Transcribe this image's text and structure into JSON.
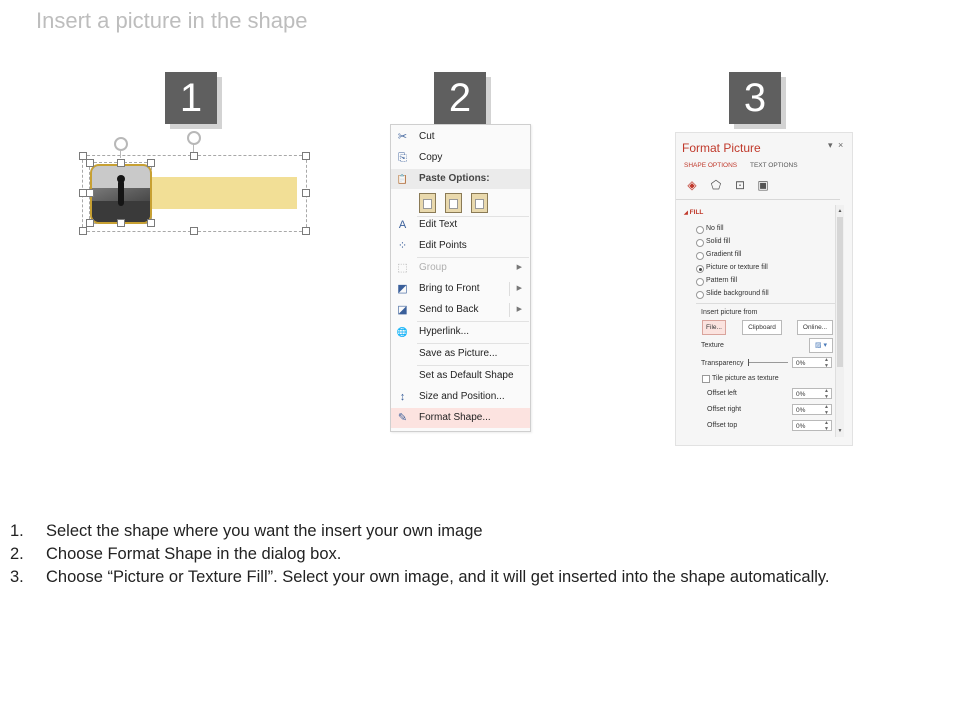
{
  "title": "Insert a picture in the shape",
  "steps": [
    "1",
    "2",
    "3"
  ],
  "context_menu": {
    "items": [
      {
        "label": "Cut",
        "icon": "cut-icon",
        "glyph": "✂"
      },
      {
        "label": "Copy",
        "icon": "copy-icon",
        "glyph": "⎘"
      },
      {
        "label": "Paste Options:",
        "icon": "paste-icon",
        "glyph": "📋"
      },
      {
        "label": "Edit Text",
        "icon": "edit-text-icon",
        "glyph": "A"
      },
      {
        "label": "Edit Points",
        "icon": "edit-points-icon",
        "glyph": "⁘"
      },
      {
        "label": "Group",
        "icon": "group-icon",
        "glyph": "⬚"
      },
      {
        "label": "Bring to Front",
        "icon": "bring-to-front-icon",
        "glyph": "◩"
      },
      {
        "label": "Send to Back",
        "icon": "send-to-back-icon",
        "glyph": "◪"
      },
      {
        "label": "Hyperlink...",
        "icon": "hyperlink-icon",
        "glyph": "🌐"
      },
      {
        "label": "Save as Picture...",
        "icon": "",
        "glyph": ""
      },
      {
        "label": "Set as Default Shape",
        "icon": "",
        "glyph": ""
      },
      {
        "label": "Size and Position...",
        "icon": "size-position-icon",
        "glyph": "↕"
      },
      {
        "label": "Format Shape...",
        "icon": "format-shape-icon",
        "glyph": "✎"
      }
    ]
  },
  "format_pane": {
    "title": "Format Picture",
    "dropdown_glyph": "▾",
    "close_glyph": "×",
    "tabs": [
      "SHAPE OPTIONS",
      "TEXT OPTIONS"
    ],
    "tab_icons": [
      {
        "name": "fill-line-icon",
        "glyph": "◈"
      },
      {
        "name": "effects-icon",
        "glyph": "⬠"
      },
      {
        "name": "size-properties-icon",
        "glyph": "⊡"
      },
      {
        "name": "picture-icon",
        "glyph": "▣"
      }
    ],
    "section": "FILL",
    "section_glyph": "◢",
    "fill_options": [
      {
        "label": "No fill",
        "selected": false
      },
      {
        "label": "Solid fill",
        "selected": false
      },
      {
        "label": "Gradient fill",
        "selected": false
      },
      {
        "label": "Picture or texture fill",
        "selected": true
      },
      {
        "label": "Pattern fill",
        "selected": false
      },
      {
        "label": "Slide background fill",
        "selected": false
      }
    ],
    "insert_from_label": "Insert picture from",
    "buttons": [
      "File...",
      "Clipboard",
      "Online..."
    ],
    "texture_label": "Texture",
    "transparency_label": "Transparency",
    "transparency_value": "0%",
    "tile_label": "Tile picture as texture",
    "offsets": [
      {
        "label": "Offset left",
        "value": "0%"
      },
      {
        "label": "Offset right",
        "value": "0%"
      },
      {
        "label": "Offset top",
        "value": "0%"
      }
    ]
  },
  "instructions": [
    {
      "num": "1.",
      "text": "Select the shape where you want the insert your own image"
    },
    {
      "num": "2.",
      "text": "Choose Format Shape in the dialog box."
    },
    {
      "num": "3.",
      "text": "Choose “Picture or Texture Fill”. Select your own image, and it will get inserted into the shape automatically."
    }
  ]
}
